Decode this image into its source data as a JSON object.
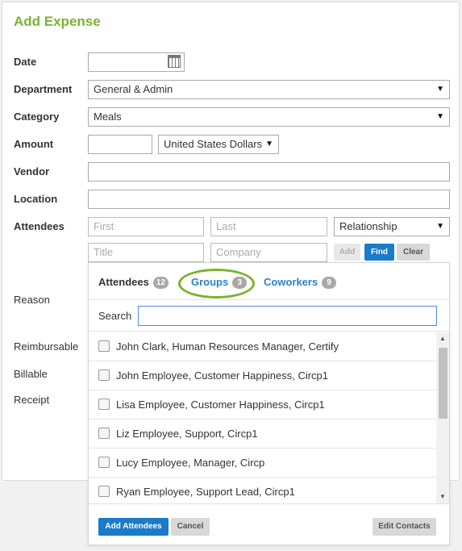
{
  "title": "Add Expense",
  "labels": {
    "date": "Date",
    "department": "Department",
    "category": "Category",
    "amount": "Amount",
    "vendor": "Vendor",
    "location": "Location",
    "attendees": "Attendees",
    "reason": "Reason",
    "reimbursable": "Reimbursable",
    "billable": "Billable",
    "receipt": "Receipt"
  },
  "fields": {
    "date_value": "",
    "department_value": "General & Admin",
    "category_value": "Meals",
    "amount_value": "",
    "currency_value": "United States Dollars",
    "vendor_value": "",
    "location_value": ""
  },
  "attendee_form": {
    "first_placeholder": "First",
    "last_placeholder": "Last",
    "relationship_value": "Relationship",
    "title_placeholder": "Title",
    "company_placeholder": "Company",
    "add_label": "Add",
    "find_label": "Find",
    "clear_label": "Clear"
  },
  "popup": {
    "tabs": [
      {
        "label": "Attendees",
        "count": "12"
      },
      {
        "label": "Groups",
        "count": "3"
      },
      {
        "label": "Coworkers",
        "count": "9"
      }
    ],
    "search_label": "Search",
    "search_value": "",
    "items": [
      "John Clark, Human Resources Manager, Certify",
      "John Employee, Customer Happiness, Circp1",
      "Lisa Employee, Customer Happiness, Circp1",
      "Liz Employee, Support, Circp1",
      "Lucy Employee, Manager, Circp",
      "Ryan Employee, Support Lead, Circp1"
    ],
    "add_attendees_label": "Add Attendees",
    "cancel_label": "Cancel",
    "edit_contacts_label": "Edit Contacts"
  },
  "colors": {
    "accent_green": "#7ab32e",
    "primary_blue": "#1a7bc9",
    "link_blue": "#2f80c8"
  }
}
